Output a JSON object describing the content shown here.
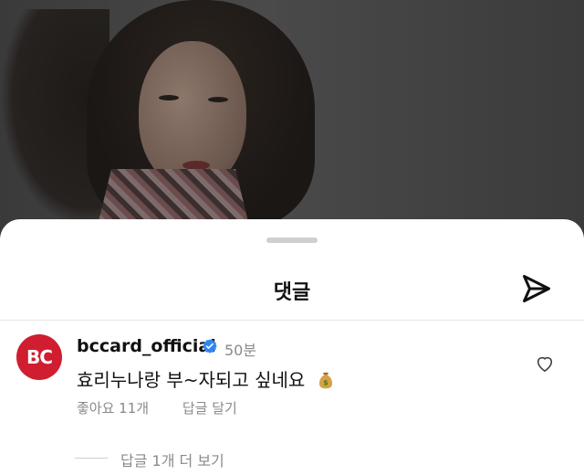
{
  "sheet": {
    "title": "댓글"
  },
  "comment": {
    "username": "bccard_official",
    "time": "50분",
    "text": "효리누나랑 부~자되고 싶네요",
    "likes_label": "좋아요 11개",
    "reply_label": "답글 달기",
    "avatar_text": "BC"
  },
  "replies": {
    "label": "답글 1개 더 보기"
  },
  "icons": {
    "send": "send-icon",
    "heart": "heart-icon",
    "verified": "verified-badge-icon",
    "money": "money-bag-emoji"
  },
  "colors": {
    "brand": "#d01d30",
    "verified": "#2f86f6",
    "muted": "#8a8a8a"
  }
}
